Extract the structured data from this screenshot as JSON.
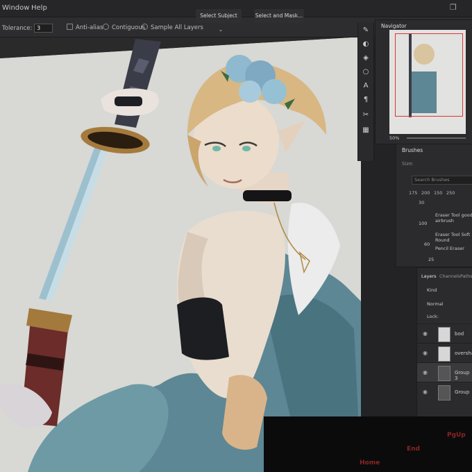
{
  "menubar": {
    "items": [
      "Window",
      "Help"
    ]
  },
  "options": {
    "tolerance_label": "Tolerance:",
    "tolerance_value": "3",
    "antialias": "Anti-alias",
    "contiguous": "Contiguous",
    "sample_all": "Sample All Layers",
    "select_subject": "Select Subject",
    "select_mask": "Select and Mask..."
  },
  "navigator": {
    "title": "Navigator",
    "zoom": "50%"
  },
  "brushes": {
    "title": "Brushes",
    "size_label": "Size:",
    "search_placeholder": "Search Brushes",
    "sizes": [
      "175",
      "200",
      "150",
      "250",
      "30"
    ],
    "items": [
      {
        "size": "100",
        "name": "Eraser Tool good airbrush"
      },
      {
        "size": "60",
        "name": "Eraser Tool Soft Round"
      },
      {
        "size": "25",
        "name": "Pencil Eraser"
      }
    ]
  },
  "layers": {
    "tabs": [
      "Layers",
      "Channels",
      "Paths"
    ],
    "kind": "Kind",
    "blend": "Normal",
    "lock": "Lock:",
    "rows": [
      "bod",
      "overshad",
      "Group 3",
      "Group"
    ]
  },
  "keyboard": {
    "keys": [
      "Home",
      "End",
      "PgUp"
    ]
  }
}
